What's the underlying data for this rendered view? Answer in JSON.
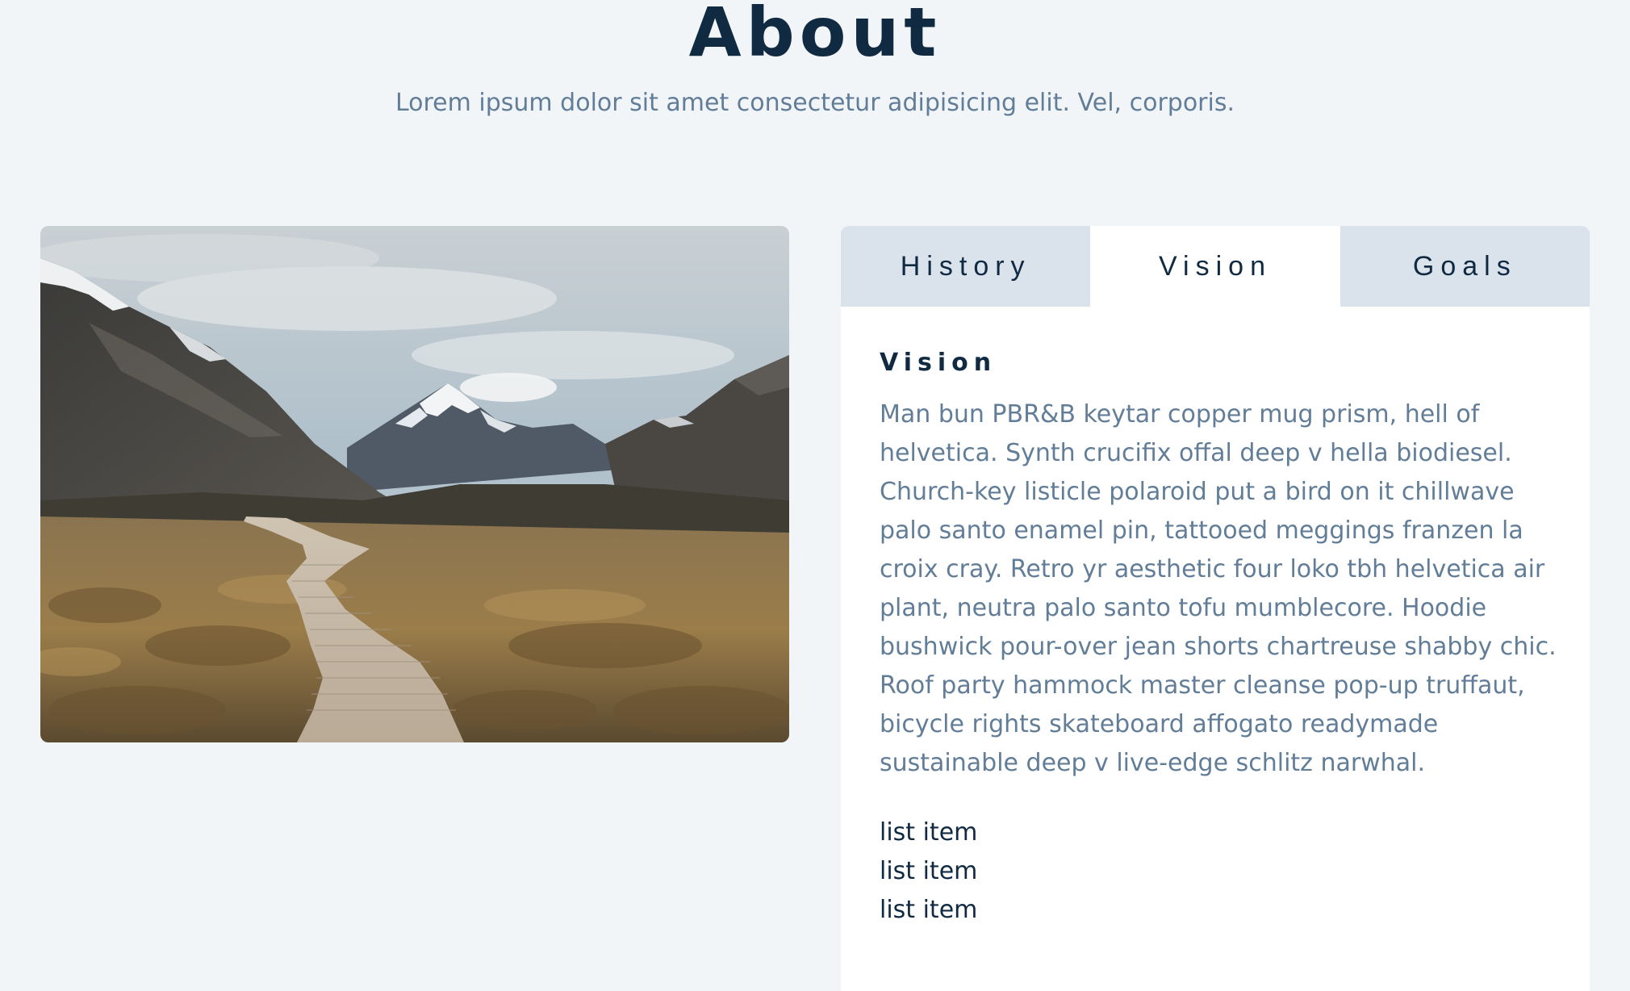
{
  "header": {
    "title": "About",
    "subtitle": "Lorem ipsum dolor sit amet consectetur adipisicing elit. Vel, corporis."
  },
  "image": {
    "icon": "mountain-boardwalk-photo"
  },
  "tabs": [
    {
      "label": "History",
      "active": false
    },
    {
      "label": "Vision",
      "active": true
    },
    {
      "label": "Goals",
      "active": false
    }
  ],
  "content": {
    "title": "Vision",
    "text": "Man bun PBR&B keytar copper mug prism, hell of helvetica. Synth crucifix offal deep v hella biodiesel. Church-key listicle polaroid put a bird on it chillwave palo santo enamel pin, tattooed meggings franzen la croix cray. Retro yr aesthetic four loko tbh helvetica air plant, neutra palo santo tofu mumblecore. Hoodie bushwick pour-over jean shorts chartreuse shabby chic. Roof party hammock master cleanse pop-up truffaut, bicycle rights skateboard affogato readymade sustainable deep v live-edge schlitz narwhal.",
    "list": [
      "list item",
      "list item",
      "list item"
    ]
  },
  "colors": {
    "background": "#f1f5f8",
    "heading": "#102a42",
    "body_text": "#617d98",
    "inactive_tab": "#dae2ec",
    "active_tab": "#ffffff"
  }
}
